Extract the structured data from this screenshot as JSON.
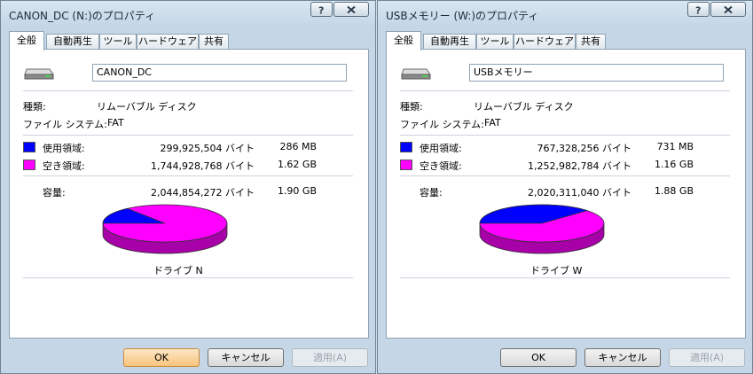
{
  "colors": {
    "used": "#0000ff",
    "free": "#ff00ff",
    "used_side": "#0000a0",
    "free_side": "#a800a8"
  },
  "icons": {
    "help": "question-mark-icon",
    "close": "close-x-icon",
    "drive": "removable-drive-icon"
  },
  "dialogs": [
    {
      "title": "CANON_DC (N:)のプロパティ",
      "tabs": [
        "全般",
        "自動再生",
        "ツール",
        "ハードウェア",
        "共有"
      ],
      "name_value": "CANON_DC",
      "type_label": "種類:",
      "type_value": "リムーバブル ディスク",
      "fs_label": "ファイル システム:",
      "fs_value": "FAT",
      "used_label": "使用領域:",
      "used_bytes": "299,925,504 バイト",
      "used_size": "286 MB",
      "free_label": "空き領域:",
      "free_bytes": "1,744,928,768 バイト",
      "free_size": "1.62 GB",
      "capacity_label": "容量:",
      "capacity_bytes": "2,044,854,272 バイト",
      "capacity_size": "1.90 GB",
      "drive_label": "ドライブ N",
      "used_fraction": 0.1467,
      "buttons": {
        "ok": "OK",
        "cancel": "キャンセル",
        "apply": "適用(A)"
      }
    },
    {
      "title": "USBメモリー (W:)のプロパティ",
      "tabs": [
        "全般",
        "自動再生",
        "ツール",
        "ハードウェア",
        "共有"
      ],
      "name_value": "USBメモリー",
      "type_label": "種類:",
      "type_value": "リムーバブル ディスク",
      "fs_label": "ファイル システム:",
      "fs_value": "FAT",
      "used_label": "使用領域:",
      "used_bytes": "767,328,256 バイト",
      "used_size": "731 MB",
      "free_label": "空き領域:",
      "free_bytes": "1,252,982,784 バイト",
      "free_size": "1.16 GB",
      "capacity_label": "容量:",
      "capacity_bytes": "2,020,311,040 バイト",
      "capacity_size": "1.88 GB",
      "drive_label": "ドライブ W",
      "used_fraction": 0.3798,
      "buttons": {
        "ok": "OK",
        "cancel": "キャンセル",
        "apply": "適用(A)"
      }
    }
  ]
}
